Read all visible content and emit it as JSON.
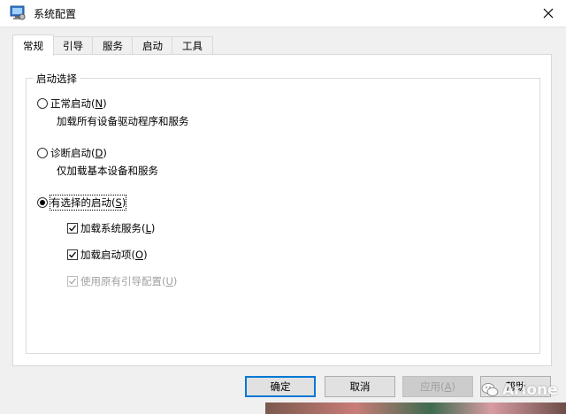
{
  "window": {
    "title": "系统配置"
  },
  "tabs": [
    {
      "label": "常规",
      "active": true
    },
    {
      "label": "引导",
      "active": false
    },
    {
      "label": "服务",
      "active": false
    },
    {
      "label": "启动",
      "active": false
    },
    {
      "label": "工具",
      "active": false
    }
  ],
  "startup_selection": {
    "group_title": "启动选择",
    "normal": {
      "label": "正常启动(",
      "key": "N",
      "suffix": ")",
      "description": "加载所有设备驱动程序和服务",
      "selected": false
    },
    "diagnostic": {
      "label": "诊断启动(",
      "key": "D",
      "suffix": ")",
      "description": "仅加载基本设备和服务",
      "selected": false
    },
    "selective": {
      "label": "有选择的启动(",
      "key": "S",
      "suffix": ")",
      "selected": true,
      "options": {
        "load_services": {
          "label": "加载系统服务(",
          "key": "L",
          "suffix": ")",
          "checked": true,
          "enabled": true
        },
        "load_startup": {
          "label": "加载启动项(",
          "key": "O",
          "suffix": ")",
          "checked": true,
          "enabled": true
        },
        "use_original_boot": {
          "label": "使用原有引导配置(",
          "key": "U",
          "suffix": ")",
          "checked": true,
          "enabled": false
        }
      }
    }
  },
  "buttons": {
    "ok": "确定",
    "cancel": "取消",
    "apply": {
      "label": "应用(",
      "key": "A",
      "suffix": ")"
    },
    "help": {
      "label": "帮助"
    }
  },
  "watermark": {
    "text": "Arione"
  },
  "colors": {
    "focus_blue": "#0078d7",
    "disabled_text": "#a0a0a0"
  }
}
